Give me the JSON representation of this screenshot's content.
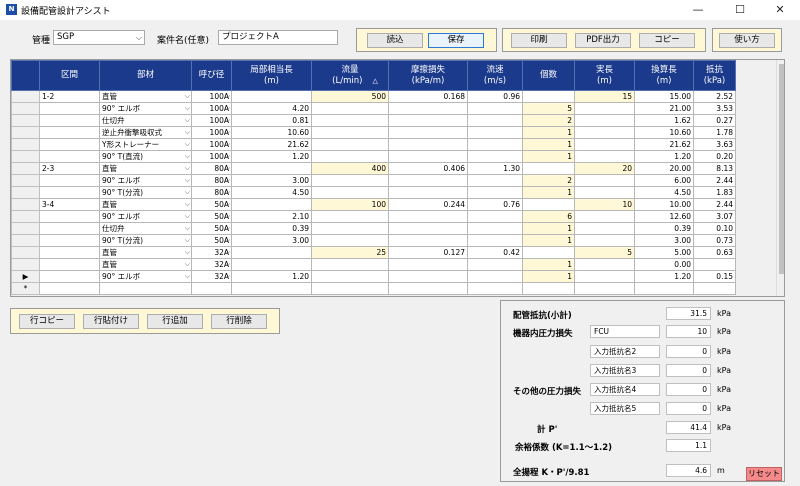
{
  "window": {
    "title": "設備配管設計アシスト",
    "min": "—",
    "max": "☐",
    "close": "✕"
  },
  "toolbar": {
    "kanshu_label": "管種",
    "kanshu_value": "SGP",
    "anken_label": "案件名(任意)",
    "anken_value": "プロジェクトA",
    "load": "読込",
    "save": "保存",
    "print": "印刷",
    "pdf": "PDF出力",
    "copy": "コピー",
    "help": "使い方"
  },
  "table": {
    "headers": [
      {
        "l1": "区間",
        "l2": ""
      },
      {
        "l1": "部材",
        "l2": ""
      },
      {
        "l1": "呼び径",
        "l2": ""
      },
      {
        "l1": "局部相当長",
        "l2": "(m)"
      },
      {
        "l1": "流量",
        "l2": "(L/min)"
      },
      {
        "l1": "摩擦損失",
        "l2": "(kPa/m)"
      },
      {
        "l1": "流速",
        "l2": "(m/s)"
      },
      {
        "l1": "個数",
        "l2": ""
      },
      {
        "l1": "実長",
        "l2": "(m)"
      },
      {
        "l1": "換算長",
        "l2": "(m)"
      },
      {
        "l1": "抵抗",
        "l2": "(kPa)"
      }
    ],
    "sort_mark": "△",
    "rows": [
      {
        "ku": "1-2",
        "bu": "直管",
        "ko": "100A",
        "kyo": "",
        "ryu": "500",
        "ma": "0.168",
        "sok": "0.96",
        "ko2": "",
        "ji": "15",
        "kan": "15.00",
        "tei": "2.52"
      },
      {
        "ku": "",
        "bu": "90° エルボ",
        "ko": "100A",
        "kyo": "4.20",
        "ryu": "",
        "ma": "",
        "sok": "",
        "ko2": "5",
        "ji": "",
        "kan": "21.00",
        "tei": "3.53"
      },
      {
        "ku": "",
        "bu": "仕切弁",
        "ko": "100A",
        "kyo": "0.81",
        "ryu": "",
        "ma": "",
        "sok": "",
        "ko2": "2",
        "ji": "",
        "kan": "1.62",
        "tei": "0.27"
      },
      {
        "ku": "",
        "bu": "逆止弁衝撃吸収式",
        "ko": "100A",
        "kyo": "10.60",
        "ryu": "",
        "ma": "",
        "sok": "",
        "ko2": "1",
        "ji": "",
        "kan": "10.60",
        "tei": "1.78"
      },
      {
        "ku": "",
        "bu": "Y形ストレーナー",
        "ko": "100A",
        "kyo": "21.62",
        "ryu": "",
        "ma": "",
        "sok": "",
        "ko2": "1",
        "ji": "",
        "kan": "21.62",
        "tei": "3.63"
      },
      {
        "ku": "",
        "bu": "90° T(直流)",
        "ko": "100A",
        "kyo": "1.20",
        "ryu": "",
        "ma": "",
        "sok": "",
        "ko2": "1",
        "ji": "",
        "kan": "1.20",
        "tei": "0.20"
      },
      {
        "ku": "2-3",
        "bu": "直管",
        "ko": "80A",
        "kyo": "",
        "ryu": "400",
        "ma": "0.406",
        "sok": "1.30",
        "ko2": "",
        "ji": "20",
        "kan": "20.00",
        "tei": "8.13"
      },
      {
        "ku": "",
        "bu": "90° エルボ",
        "ko": "80A",
        "kyo": "3.00",
        "ryu": "",
        "ma": "",
        "sok": "",
        "ko2": "2",
        "ji": "",
        "kan": "6.00",
        "tei": "2.44"
      },
      {
        "ku": "",
        "bu": "90° T(分流)",
        "ko": "80A",
        "kyo": "4.50",
        "ryu": "",
        "ma": "",
        "sok": "",
        "ko2": "1",
        "ji": "",
        "kan": "4.50",
        "tei": "1.83"
      },
      {
        "ku": "3-4",
        "bu": "直管",
        "ko": "50A",
        "kyo": "",
        "ryu": "100",
        "ma": "0.244",
        "sok": "0.76",
        "ko2": "",
        "ji": "10",
        "kan": "10.00",
        "tei": "2.44"
      },
      {
        "ku": "",
        "bu": "90° エルボ",
        "ko": "50A",
        "kyo": "2.10",
        "ryu": "",
        "ma": "",
        "sok": "",
        "ko2": "6",
        "ji": "",
        "kan": "12.60",
        "tei": "3.07"
      },
      {
        "ku": "",
        "bu": "仕切弁",
        "ko": "50A",
        "kyo": "0.39",
        "ryu": "",
        "ma": "",
        "sok": "",
        "ko2": "1",
        "ji": "",
        "kan": "0.39",
        "tei": "0.10"
      },
      {
        "ku": "",
        "bu": "90° T(分流)",
        "ko": "50A",
        "kyo": "3.00",
        "ryu": "",
        "ma": "",
        "sok": "",
        "ko2": "1",
        "ji": "",
        "kan": "3.00",
        "tei": "0.73"
      },
      {
        "ku": "",
        "bu": "直管",
        "ko": "32A",
        "kyo": "",
        "ryu": "25",
        "ma": "0.127",
        "sok": "0.42",
        "ko2": "",
        "ji": "5",
        "kan": "5.00",
        "tei": "0.63"
      },
      {
        "ku": "",
        "bu": "直管",
        "ko": "32A",
        "kyo": "",
        "ryu": "",
        "ma": "",
        "sok": "",
        "ko2": "1",
        "ji": "",
        "kan": "0.00",
        "tei": ""
      },
      {
        "ku": "",
        "bu": "90° エルボ",
        "ko": "32A",
        "kyo": "1.20",
        "ryu": "",
        "ma": "",
        "sok": "",
        "ko2": "1",
        "ji": "",
        "kan": "1.20",
        "tei": "0.15"
      }
    ],
    "current_row_marker": "▶",
    "new_row_marker": "*"
  },
  "row_buttons": {
    "copy": "行コピー",
    "paste": "行貼付け",
    "add": "行追加",
    "delete": "行削除"
  },
  "results": {
    "pipe_resist_label": "配管抵抗(小計)",
    "pipe_resist_value": "31.5",
    "pipe_resist_unit": "kPa",
    "equip_label": "機器内圧力損失",
    "equip_name": "FCU",
    "equip_value": "10",
    "equip_unit": "kPa",
    "input2_name": "入力抵抗名2",
    "input2_value": "0",
    "input2_unit": "kPa",
    "input3_name": "入力抵抗名3",
    "input3_value": "0",
    "input3_unit": "kPa",
    "other_label": "その他の圧力損失",
    "input4_name": "入力抵抗名4",
    "input4_value": "0",
    "input4_unit": "kPa",
    "input5_name": "入力抵抗名5",
    "input5_value": "0",
    "input5_unit": "kPa",
    "total_label": "計 P'",
    "total_value": "41.4",
    "total_unit": "kPa",
    "margin_label": "余裕係数 (K=1.1～1.2)",
    "margin_value": "1.1",
    "head_label": "全揚程  K・P'/9.81",
    "head_value": "4.6",
    "head_unit": "m",
    "reset": "リセット"
  }
}
